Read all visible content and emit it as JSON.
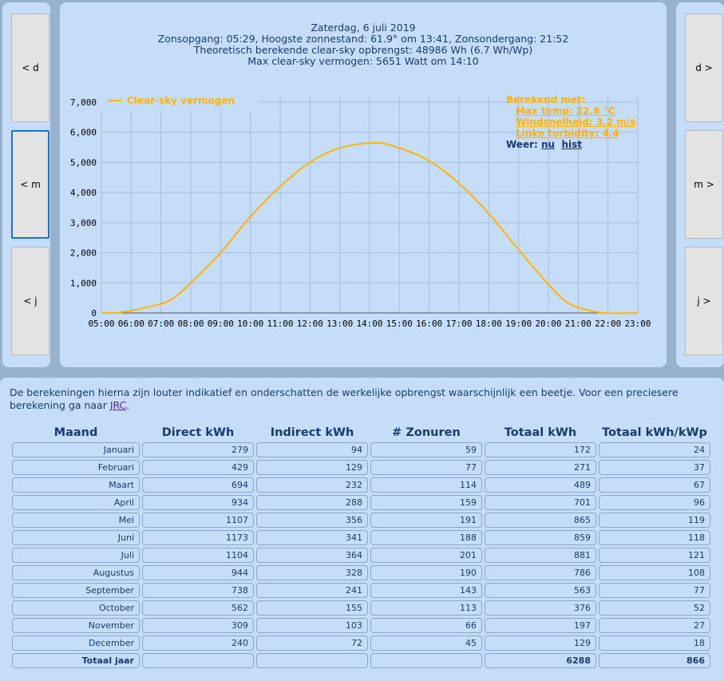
{
  "nav": {
    "prev_day": "< d",
    "prev_month": "< m",
    "prev_year": "< j",
    "next_day": "d >",
    "next_month": "m >",
    "next_year": "j >"
  },
  "header": {
    "line1": "Zaterdag, 6 juli 2019",
    "line2": "Zonsopgang: 05:29, Hoogste zonnestand: 61.9° om 13:41, Zonsondergang: 21:52",
    "line3": "Theoretisch berekende clear-sky opbrengst: 48986 Wh (6.7 Wh/Wp)",
    "line4": "Max clear-sky vermogen: 5651 Watt om 14:10"
  },
  "info": {
    "title": "Berekend met:",
    "temp": "Max temp: 22.8 °C",
    "wind": "Windsnelheid: 3.2 m/s",
    "linke": "Linke turbidity: 4.4",
    "weer": "Weer:",
    "nu": "nu",
    "hist": "hist"
  },
  "colors": {
    "curve": "#ffb400",
    "panel": "#c6ddfa"
  },
  "chart_data": {
    "type": "line",
    "legend": "Clear-sky vermogen",
    "legend_position": "top-left",
    "ylim": [
      0,
      7000
    ],
    "yticks": [
      "0",
      "1,000",
      "2,000",
      "3,000",
      "4,000",
      "5,000",
      "6,000",
      "7,000"
    ],
    "xticks": [
      "05:00",
      "06:00",
      "07:00",
      "08:00",
      "09:00",
      "10:00",
      "11:00",
      "12:00",
      "13:00",
      "14:00",
      "15:00",
      "16:00",
      "17:00",
      "18:00",
      "19:00",
      "20:00",
      "21:00",
      "22:00",
      "23:00"
    ],
    "x": [
      5,
      5.48,
      6,
      7,
      7.5,
      8,
      9,
      10,
      11,
      12,
      13,
      14.17,
      15,
      16,
      17,
      18,
      19,
      20,
      20.5,
      21,
      21.87,
      23
    ],
    "y": [
      0,
      0,
      80,
      300,
      550,
      1000,
      2000,
      3200,
      4200,
      5000,
      5480,
      5651,
      5480,
      5050,
      4300,
      3300,
      2100,
      950,
      450,
      180,
      0,
      0
    ]
  },
  "note": {
    "text": "De berekeningen hierna zijn louter indikatief en onderschatten de werkelijke opbrengst waarschijnlijk een beetje. Voor een preciesere berekening ga naar ",
    "link": "JRC",
    "end": "."
  },
  "table": {
    "headers": [
      "Maand",
      "Direct kWh",
      "Indirect kWh",
      "# Zonuren",
      "Totaal kWh",
      "Totaal kWh/kWp"
    ],
    "rows": [
      [
        "Januari",
        "279",
        "94",
        "59",
        "172",
        "24"
      ],
      [
        "Februari",
        "429",
        "129",
        "77",
        "271",
        "37"
      ],
      [
        "Maart",
        "694",
        "232",
        "114",
        "489",
        "67"
      ],
      [
        "April",
        "934",
        "288",
        "159",
        "701",
        "96"
      ],
      [
        "Mei",
        "1107",
        "356",
        "191",
        "865",
        "119"
      ],
      [
        "Juni",
        "1173",
        "341",
        "188",
        "859",
        "118"
      ],
      [
        "Juli",
        "1104",
        "364",
        "201",
        "881",
        "121"
      ],
      [
        "Augustus",
        "944",
        "328",
        "190",
        "786",
        "108"
      ],
      [
        "September",
        "738",
        "241",
        "143",
        "563",
        "77"
      ],
      [
        "October",
        "562",
        "155",
        "113",
        "376",
        "52"
      ],
      [
        "November",
        "309",
        "103",
        "66",
        "197",
        "27"
      ],
      [
        "December",
        "240",
        "72",
        "45",
        "129",
        "18"
      ]
    ],
    "total": [
      "Totaal jaar",
      "",
      "",
      "",
      "6288",
      "866"
    ]
  }
}
